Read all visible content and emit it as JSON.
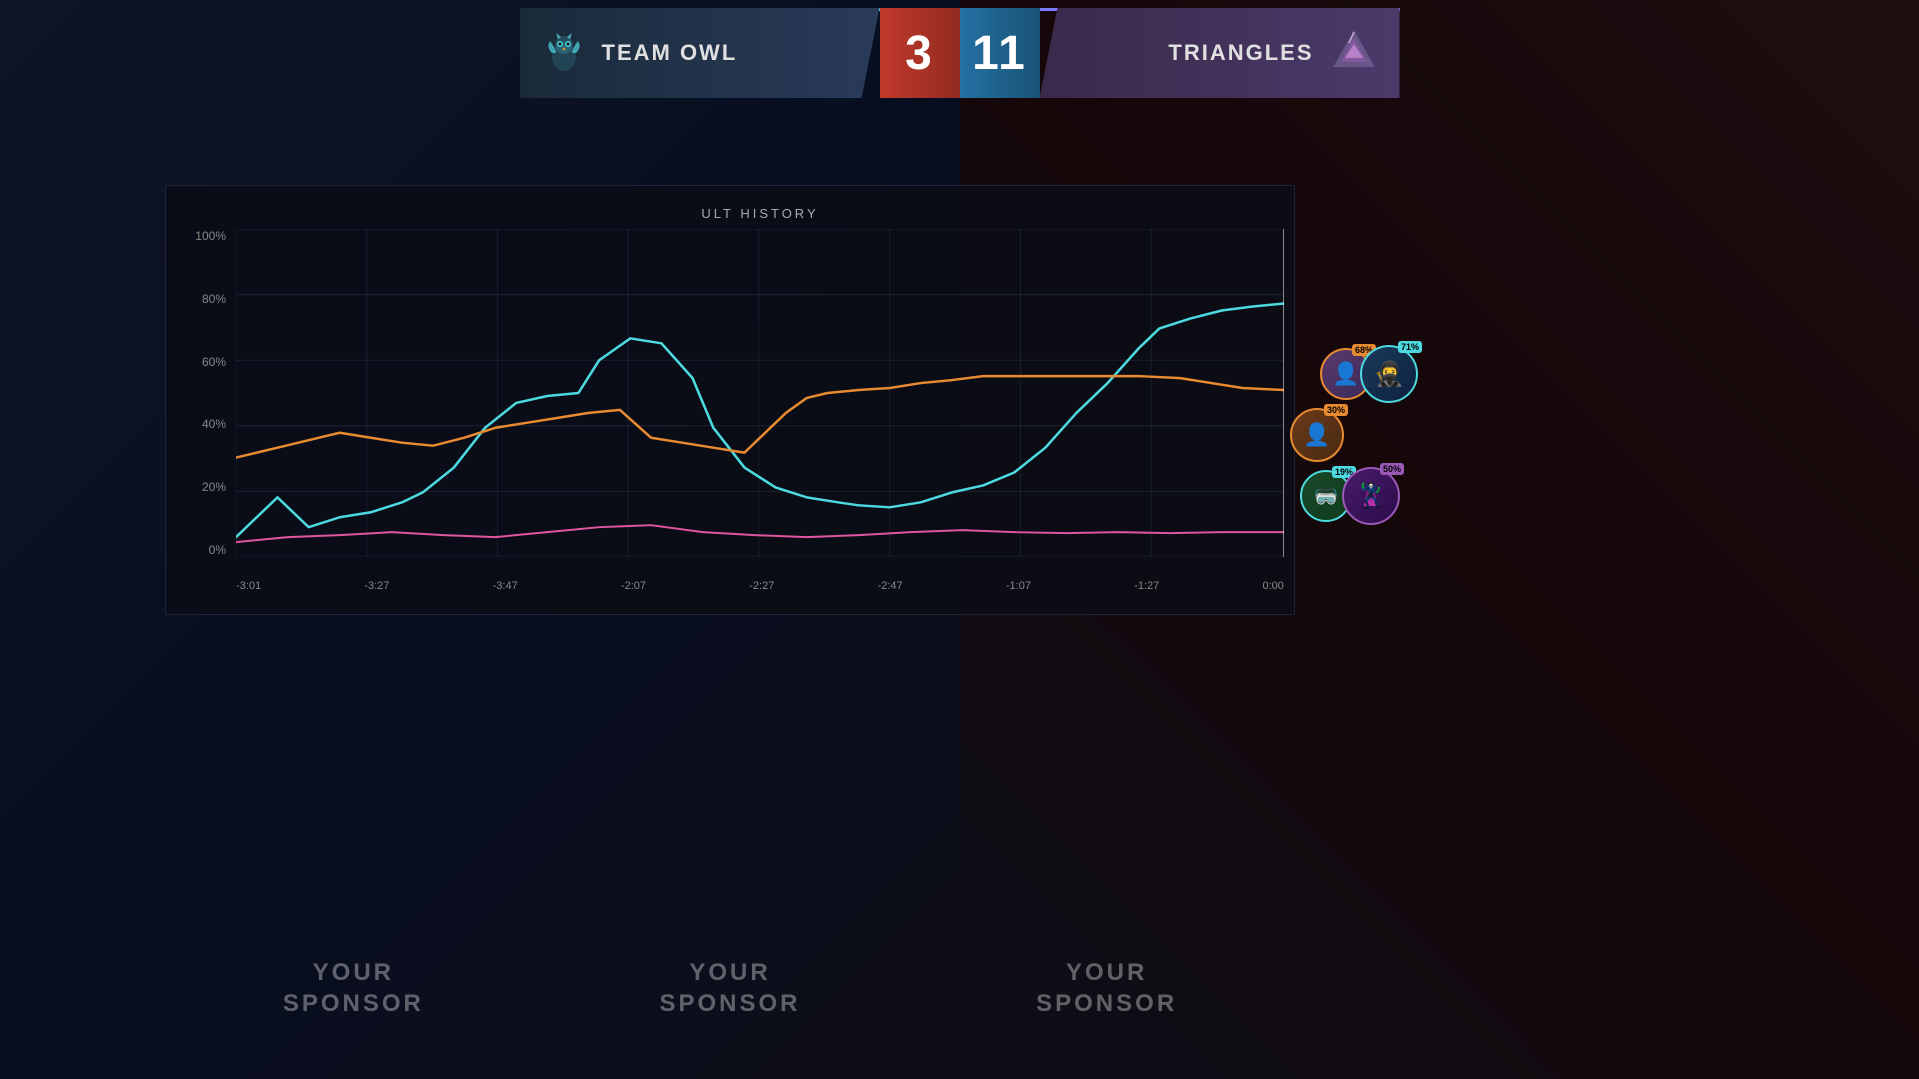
{
  "scoreboard": {
    "team_left": {
      "name": "TEAM OWL",
      "score": "3",
      "icon": "owl"
    },
    "team_right": {
      "name": "TRIANGLES",
      "score": "11",
      "icon": "triangle"
    }
  },
  "chart": {
    "title": "ULT HISTORY",
    "y_labels": [
      "0%",
      "20%",
      "40%",
      "60%",
      "80%",
      "100%"
    ],
    "x_labels": [
      "-3:01",
      "-3:27",
      "-3:47",
      "-2:07",
      "-2:27",
      "-2:47",
      "-1:07",
      "-1:27",
      "0:00"
    ]
  },
  "avatars": [
    {
      "badge": "71%",
      "badge_color": "blue",
      "position": "top-right"
    },
    {
      "badge": "68%",
      "badge_color": "orange",
      "position": "top-left"
    },
    {
      "badge": "30%",
      "badge_color": "orange",
      "position": "middle"
    },
    {
      "badge": "19%",
      "badge_color": "blue",
      "position": "bottom-left"
    },
    {
      "badge": "50%",
      "badge_color": "purple",
      "position": "bottom-right"
    }
  ],
  "sponsors": [
    {
      "text": "YOUR\nSPONSOR"
    },
    {
      "text": "YOUR\nSPONSOR"
    },
    {
      "text": "YOUR\nSPONSOR"
    }
  ]
}
